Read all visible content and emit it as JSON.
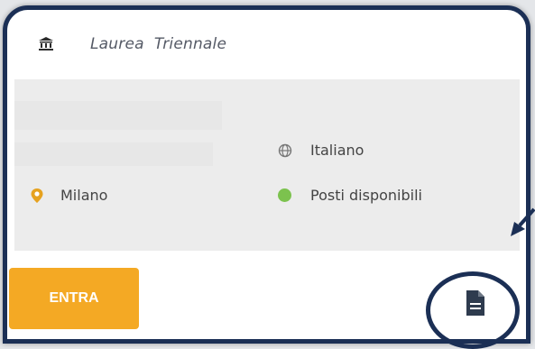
{
  "card": {
    "degree_type": "Laurea  Triennale",
    "language": "Italiano",
    "location": "Milano",
    "availability": "Posti disponibili",
    "enter_label": "ENTRA"
  },
  "icons": {
    "institution": "bank-icon",
    "language": "globe-icon",
    "location": "map-pin-icon",
    "availability": "green-dot-icon",
    "document": "document-icon"
  },
  "colors": {
    "frame": "#1b2f55",
    "accent": "#f4a924",
    "pin": "#e6a21f",
    "available": "#7cc24e"
  }
}
